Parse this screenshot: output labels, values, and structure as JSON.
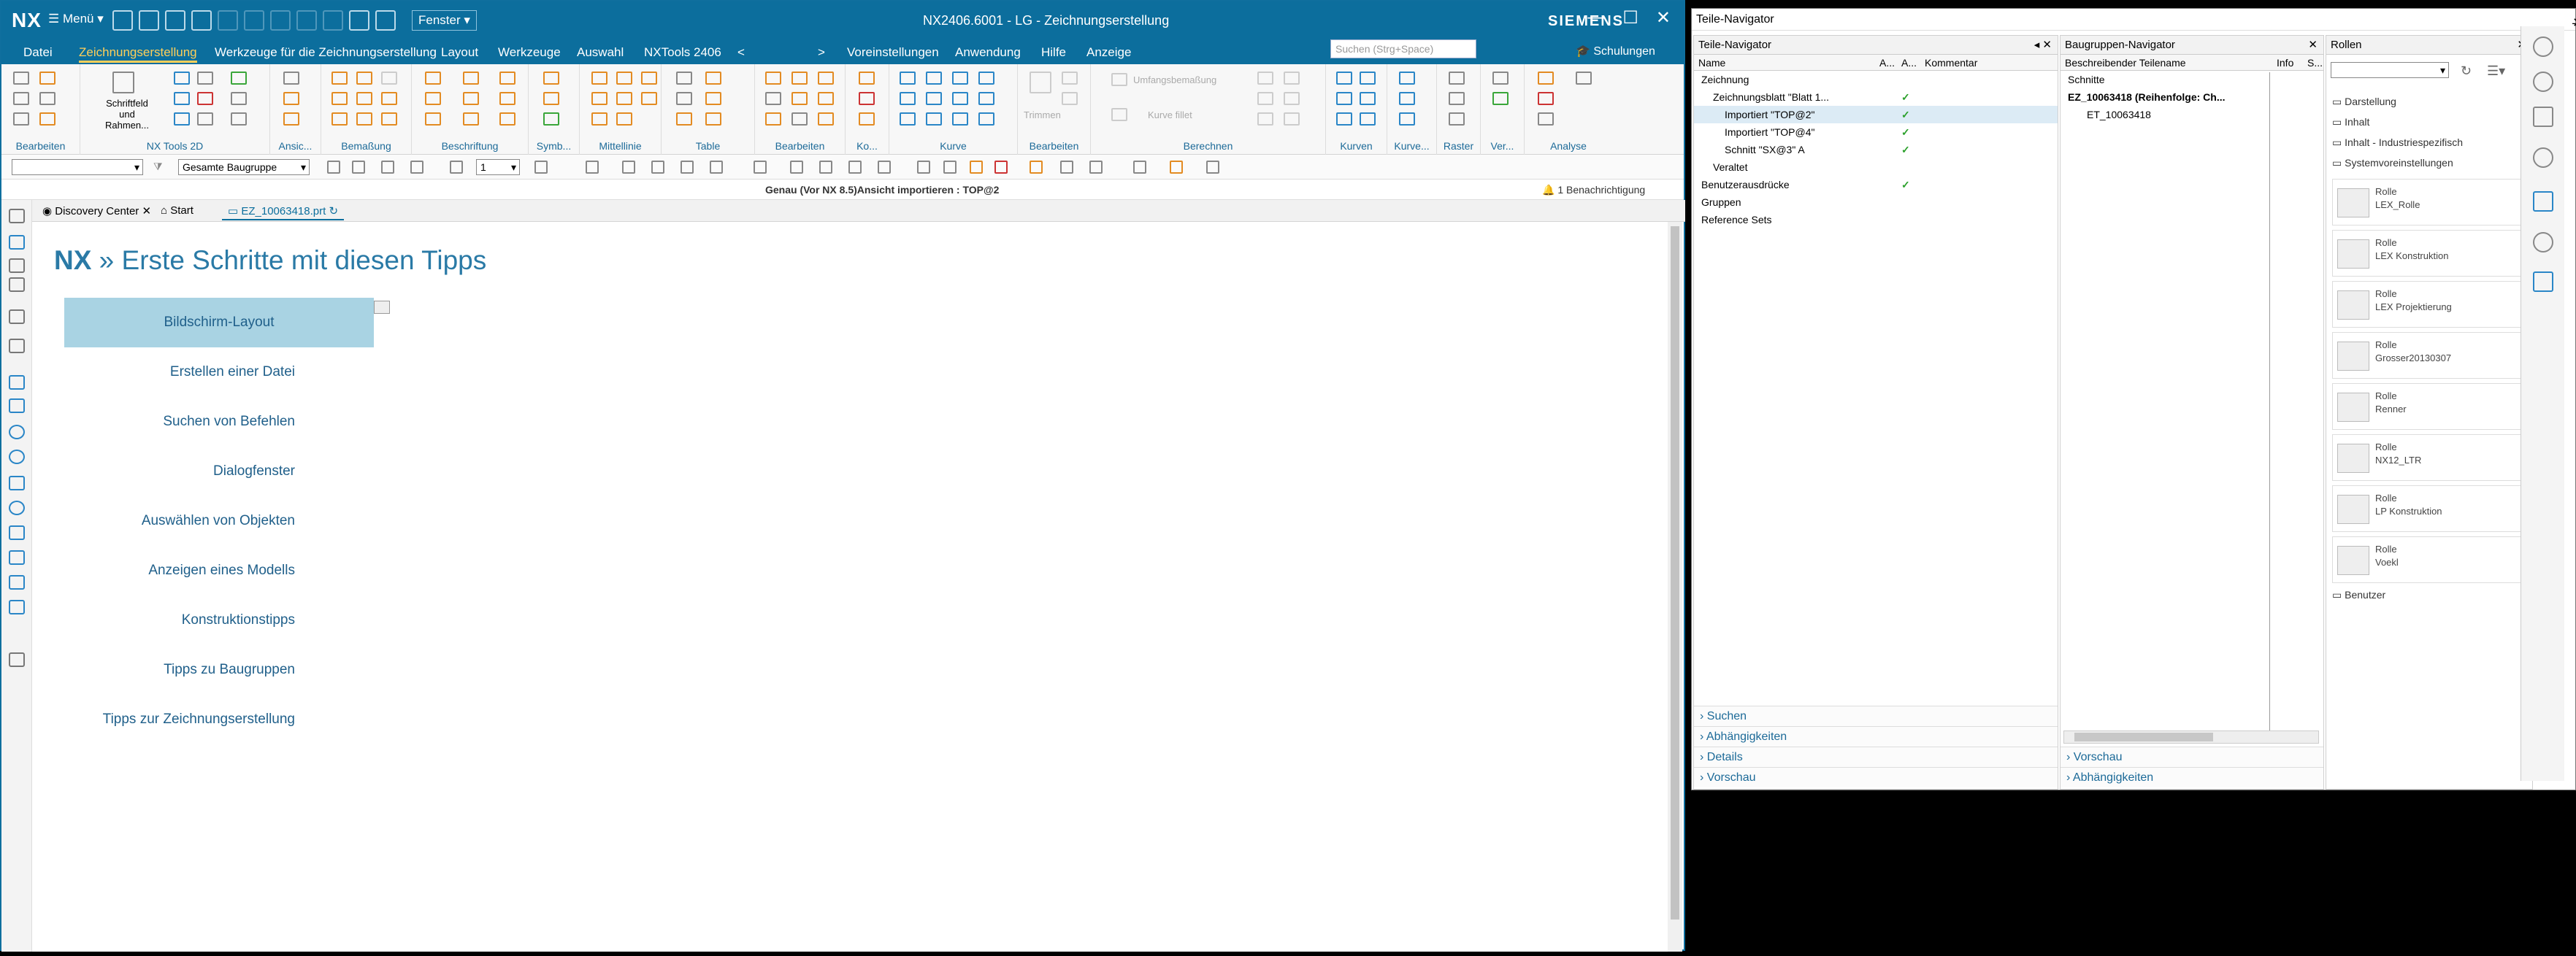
{
  "titlebar": {
    "logo": "NX",
    "menu": "Menü",
    "fenster": "Fenster",
    "title": "NX2406.6001 - LG - Zeichnungserstellung",
    "brand": "SIEMENS",
    "minimize": "—",
    "maximize": "☐",
    "close": "✕"
  },
  "menubar": {
    "items": [
      "Datei",
      "Zeichnungserstellung",
      "Werkzeuge für die Zeichnungserstellung",
      "Layout",
      "Werkzeuge",
      "Auswahl",
      "NXTools 2406",
      "<",
      ">",
      "Voreinstellungen",
      "Anwendung",
      "Hilfe",
      "Anzeige"
    ],
    "search_placeholder": "Suchen (Strg+Space)",
    "schulungen": "Schulungen"
  },
  "ribbon": {
    "groups": [
      "Bearbeiten",
      "NX Tools 2D",
      "Ansic...",
      "Bemaßung",
      "Beschriftung",
      "Symb...",
      "Mittellinie",
      "Table",
      "Bearbeiten",
      "Ko...",
      "Kurve",
      "Bearbeiten",
      "Berechnen",
      "Kurven",
      "Kurve...",
      "Raster",
      "Ver...",
      "Analyse"
    ],
    "schriftfeld": "Schriftfeld und Rahmen...",
    "trimmen": "Trimmen",
    "umfang": "Umfangsbemaßung",
    "kurve_fillet": "Kurve fillet"
  },
  "selbar": {
    "filter": "",
    "scope": "Gesamte Baugruppe",
    "layer": "1"
  },
  "statusline": {
    "message": "Genau (Vor NX 8.5)Ansicht importieren : TOP@2",
    "notifications": "1 Benachrichtigung"
  },
  "tabs": [
    "Discovery Center",
    "Start",
    "EZ_10063418.prt"
  ],
  "content": {
    "heading_prefix": "NX",
    "heading": " » Erste Schritte mit diesen Tipps",
    "items": [
      "Bildschirm-Layout",
      "Erstellen einer Datei",
      "Suchen von Befehlen",
      "Dialogfenster",
      "Auswählen von Objekten",
      "Anzeigen eines Modells",
      "Konstruktionstipps",
      "Tipps zu Baugruppen",
      "Tipps zur Zeichnungserstellung"
    ]
  },
  "rightpanel": {
    "title": "Teile-Navigator",
    "partnav": {
      "title": "Teile-Navigator",
      "cols": [
        "Name",
        "A...",
        "A...",
        "Kommentar"
      ],
      "rows": [
        {
          "label": "Zeichnung",
          "indent": 0,
          "check": ""
        },
        {
          "label": "Zeichnungsblatt \"Blatt 1...",
          "indent": 1,
          "check": "✓"
        },
        {
          "label": "Importiert \"TOP@2\"",
          "indent": 2,
          "check": "✓"
        },
        {
          "label": "Importiert \"TOP@4\"",
          "indent": 2,
          "check": "✓"
        },
        {
          "label": "Schnitt \"SX@3\" A",
          "indent": 2,
          "check": "✓"
        },
        {
          "label": "Veraltet",
          "indent": 1,
          "check": ""
        },
        {
          "label": "Benutzerausdrücke",
          "indent": 0,
          "check": "✓"
        },
        {
          "label": "Gruppen",
          "indent": 0,
          "check": ""
        },
        {
          "label": "Reference Sets",
          "indent": 0,
          "check": ""
        }
      ],
      "footers": [
        "Suchen",
        "Abhängigkeiten",
        "Details",
        "Vorschau"
      ]
    },
    "asmnav": {
      "title": "Baugruppen-Navigator",
      "cols": [
        "Beschreibender Teilename",
        "Info",
        "S..."
      ],
      "rows": [
        {
          "label": "Schnitte",
          "indent": 0
        },
        {
          "label": "EZ_10063418 (Reihenfolge: Ch...",
          "indent": 0,
          "bold": true
        },
        {
          "label": "ET_10063418",
          "indent": 1
        }
      ],
      "footers": [
        "Vorschau",
        "Abhängigkeiten"
      ]
    },
    "roles": {
      "title": "Rollen",
      "cats": [
        "Darstellung",
        "Inhalt",
        "Inhalt - Industriespezifisch",
        "Systemvoreinstellungen"
      ],
      "cards": [
        {
          "title": "Rolle",
          "name": "LEX_Rolle",
          "icon": "Leistentritz"
        },
        {
          "title": "Rolle",
          "name": "LEX Konstruktion",
          "icon": "photo"
        },
        {
          "title": "Rolle",
          "name": "LEX Projektierung",
          "icon": "photo"
        },
        {
          "title": "Rolle",
          "name": "Grosser20130307",
          "icon": "tools"
        },
        {
          "title": "Rolle",
          "name": "Renner",
          "icon": "tools"
        },
        {
          "title": "Rolle",
          "name": "NX12_LTR",
          "icon": "device"
        },
        {
          "title": "Rolle",
          "name": "LP Konstruktion",
          "icon": "device"
        },
        {
          "title": "Rolle",
          "name": "Voekl",
          "icon": "tools"
        }
      ],
      "user": "Benutzer"
    }
  },
  "colors": {
    "accent": "#0c6e9d",
    "link": "#1f5f8a",
    "active_item": "#a9d3e3"
  }
}
